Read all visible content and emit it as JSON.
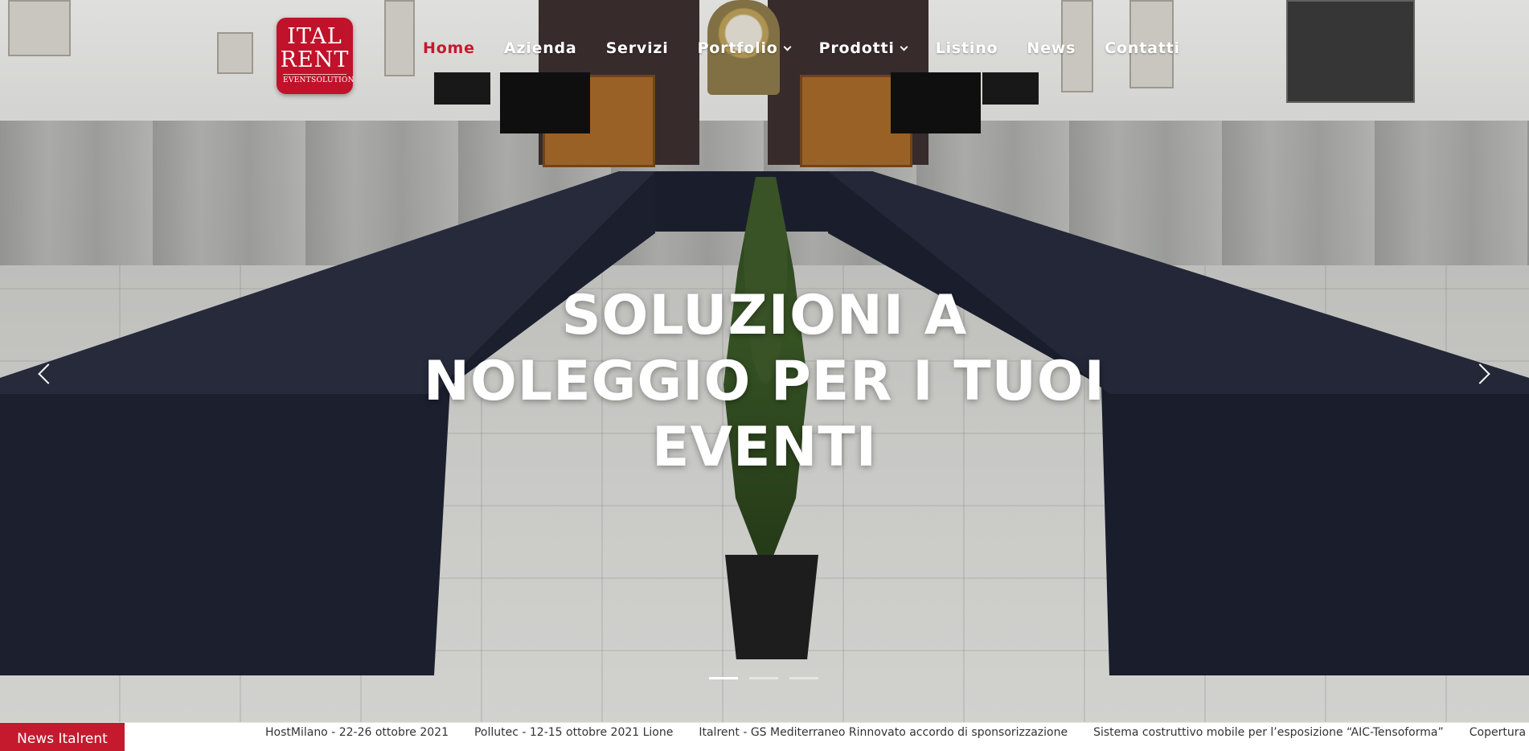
{
  "brand": {
    "logo_line1": "ITAL",
    "logo_line2": "RENT",
    "logo_line3": "EVENTSOLUTION",
    "accent_color": "#c51a2e"
  },
  "nav": {
    "home": "Home",
    "azienda": "Azienda",
    "servizi": "Servizi",
    "portfolio": "Portfolio",
    "prodotti": "Prodotti",
    "listino": "Listino",
    "news": "News",
    "contatti": "Contatti",
    "active": "Home"
  },
  "hero": {
    "line1": "SOLUZIONI A",
    "line2": "NOLEGGIO PER I TUOI",
    "line3": "EVENTI",
    "slides_total": 3,
    "slide_active": 1
  },
  "ticker": {
    "label": "News Italrent",
    "items": [
      "HostMilano - 22-26 ottobre 2021",
      "Pollutec - 12-15 ottobre 2021 Lione",
      "Italrent - GS Mediterraneo Rinnovato accordo di sponsorizzazione",
      "Sistema costruttivo mobile per l’esposizione “AIC-Tensoforma”",
      "Copertura de"
    ]
  }
}
